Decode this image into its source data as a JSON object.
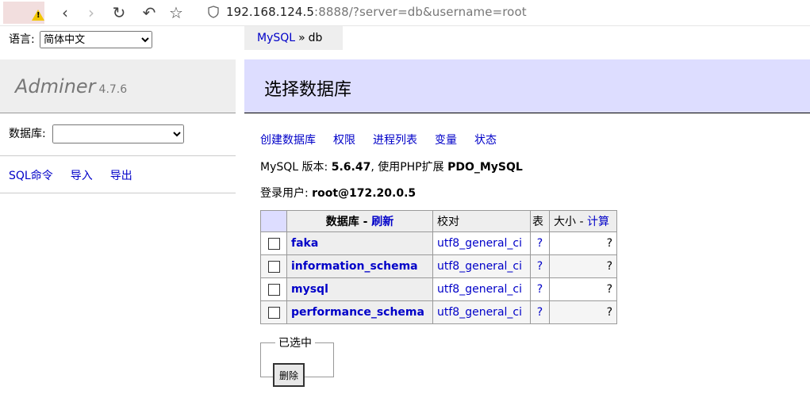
{
  "browser": {
    "url_host": "192.168.124.5",
    "url_rest": ":8888/?server=db&username=root"
  },
  "sidebar": {
    "lang_label": "语言:",
    "lang_selected": "简体中文",
    "brand_name": "Adminer",
    "brand_version": "4.7.6",
    "db_label": "数据库:",
    "db_selected": "",
    "links": [
      "SQL命令",
      "导入",
      "导出"
    ]
  },
  "breadcrumb": {
    "server": "MySQL",
    "separator": "»",
    "current": "db"
  },
  "main": {
    "title": "选择数据库",
    "links": [
      "创建数据库",
      "权限",
      "进程列表",
      "变量",
      "状态"
    ],
    "version_prefix": "MySQL 版本:",
    "version": "5.6.47",
    "ext_prefix": ", 使用PHP扩展",
    "ext": "PDO_MySQL",
    "user_prefix": "登录用户:",
    "user": "root@172.20.0.5",
    "table": {
      "col_db": "数据库",
      "col_db_sep": " - ",
      "col_db_refresh": "刷新",
      "col_collation": "校对",
      "col_tables": "表",
      "col_size": "大小",
      "col_size_sep": " - ",
      "col_size_compute": "计算",
      "rows": [
        {
          "name": "faka",
          "collation": "utf8_general_ci",
          "tables": "?",
          "size": "?"
        },
        {
          "name": "information_schema",
          "collation": "utf8_general_ci",
          "tables": "?",
          "size": "?"
        },
        {
          "name": "mysql",
          "collation": "utf8_general_ci",
          "tables": "?",
          "size": "?"
        },
        {
          "name": "performance_schema",
          "collation": "utf8_general_ci",
          "tables": "?",
          "size": "?"
        }
      ]
    },
    "selected_legend": "已选中",
    "delete_button": "删除"
  }
}
